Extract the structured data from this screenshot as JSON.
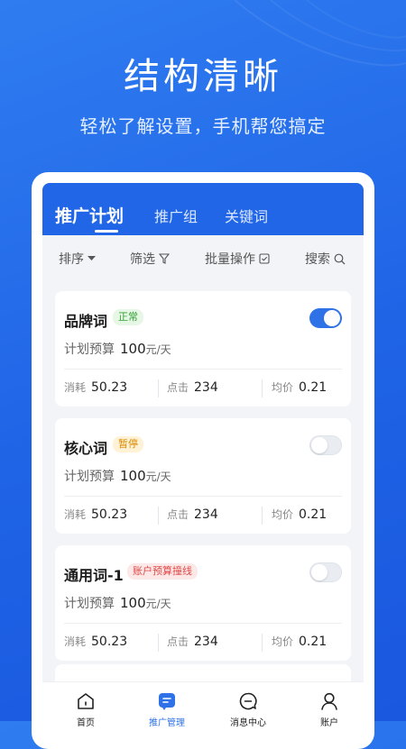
{
  "hero": {
    "title": "结构清晰",
    "subtitle": "轻松了解设置，手机帮您搞定"
  },
  "tabs": [
    {
      "label": "推广计划",
      "active": true
    },
    {
      "label": "推广组",
      "active": false
    },
    {
      "label": "关键词",
      "active": false
    }
  ],
  "filters": {
    "sort": "排序",
    "filter": "筛选",
    "batch": "批量操作",
    "search": "搜索"
  },
  "plans": [
    {
      "name": "品牌词",
      "status": "正常",
      "enabled": true,
      "budget_label": "计划预算",
      "budget": "100",
      "unit": "元/天",
      "spend_label": "消耗",
      "spend": "50.23",
      "clicks_label": "点击",
      "clicks": "234",
      "avg_label": "均价",
      "avg": "0.21"
    },
    {
      "name": "核心词",
      "status": "暂停",
      "enabled": false,
      "budget_label": "计划预算",
      "budget": "100",
      "unit": "元/天",
      "spend_label": "消耗",
      "spend": "50.23",
      "clicks_label": "点击",
      "clicks": "234",
      "avg_label": "均价",
      "avg": "0.21"
    },
    {
      "name": "通用词-1",
      "status": "账户预算撞线",
      "enabled": false,
      "budget_label": "计划预算",
      "budget": "100",
      "unit": "元/天",
      "spend_label": "消耗",
      "spend": "50.23",
      "clicks_label": "点击",
      "clicks": "234",
      "avg_label": "均价",
      "avg": "0.21"
    }
  ],
  "bottom_nav": [
    {
      "label": "首页",
      "icon": "home-icon",
      "active": false
    },
    {
      "label": "推广管理",
      "icon": "promo-management-icon",
      "active": true
    },
    {
      "label": "消息中心",
      "icon": "message-icon",
      "active": false
    },
    {
      "label": "账户",
      "icon": "account-icon",
      "active": false
    }
  ],
  "colors": {
    "primary": "#2166e6",
    "accent": "#2f72e8",
    "status_normal": "#35a135",
    "status_paused": "#d98a00",
    "status_limit": "#e04848"
  }
}
